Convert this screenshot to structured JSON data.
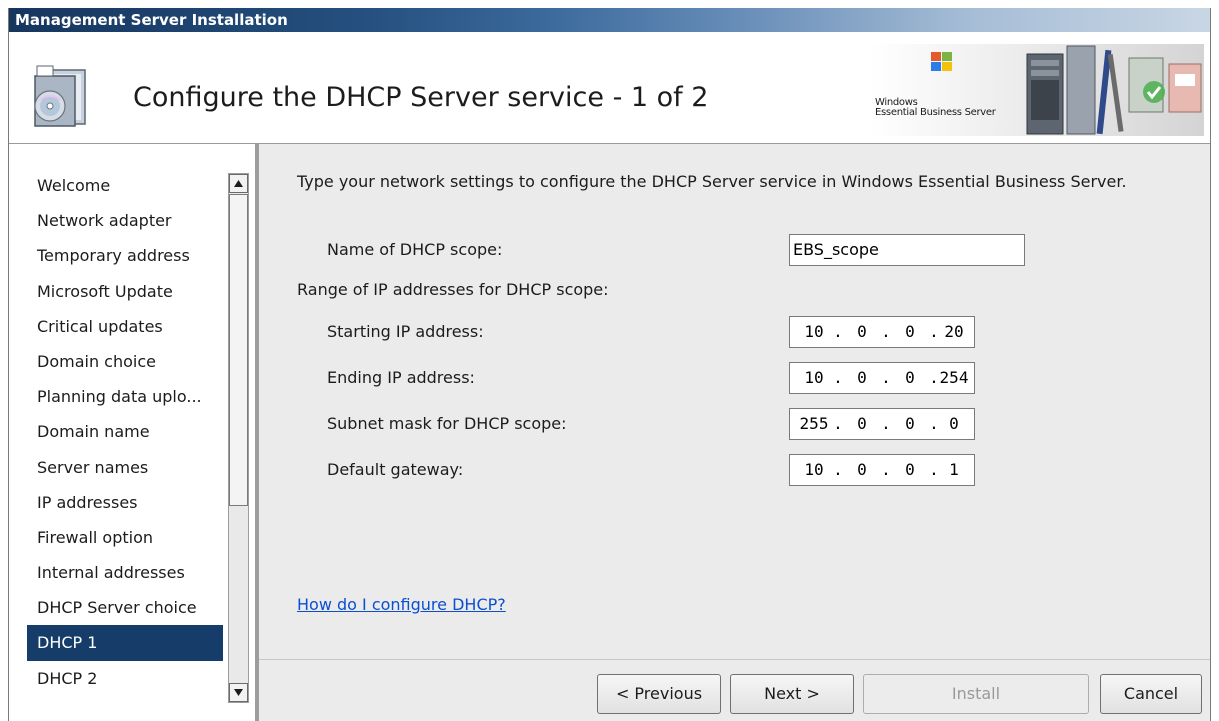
{
  "window": {
    "title": "Management Server Installation"
  },
  "header": {
    "title": "Configure the DHCP Server service - 1 of 2",
    "brand_line1": "Windows",
    "brand_line2": "Essential Business Server"
  },
  "sidebar": {
    "items": [
      {
        "label": "Welcome",
        "selected": false
      },
      {
        "label": "Network adapter",
        "selected": false
      },
      {
        "label": "Temporary address",
        "selected": false
      },
      {
        "label": "Microsoft Update",
        "selected": false
      },
      {
        "label": "Critical updates",
        "selected": false
      },
      {
        "label": "Domain choice",
        "selected": false
      },
      {
        "label": "Planning data uplo...",
        "selected": false
      },
      {
        "label": "Domain name",
        "selected": false
      },
      {
        "label": "Server names",
        "selected": false
      },
      {
        "label": "IP addresses",
        "selected": false
      },
      {
        "label": "Firewall option",
        "selected": false
      },
      {
        "label": "Internal addresses",
        "selected": false
      },
      {
        "label": "DHCP Server choice",
        "selected": false
      },
      {
        "label": "DHCP 1",
        "selected": true
      },
      {
        "label": "DHCP 2",
        "selected": false
      }
    ]
  },
  "main": {
    "instructions": "Type your network settings to configure the DHCP Server service in Windows Essential Business Server.",
    "scope_name_label": "Name of DHCP scope:",
    "scope_name_value": "EBS_scope",
    "range_label": "Range of IP addresses for DHCP scope:",
    "start_ip": {
      "label": "Starting IP address:",
      "octets": [
        "10",
        "0",
        "0",
        "20"
      ]
    },
    "end_ip": {
      "label": "Ending IP address:",
      "octets": [
        "10",
        "0",
        "0",
        "254"
      ]
    },
    "subnet_mask": {
      "label": "Subnet mask for DHCP scope:",
      "octets": [
        "255",
        "0",
        "0",
        "0"
      ]
    },
    "gateway": {
      "label": "Default gateway:",
      "octets": [
        "10",
        "0",
        "0",
        "1"
      ]
    },
    "help_link": "How do I configure DHCP?"
  },
  "footer": {
    "previous": "< Previous",
    "next": "Next >",
    "install": "Install",
    "cancel": "Cancel"
  },
  "colors": {
    "selection": "#163d6a",
    "link": "#0b4fd0",
    "titlebar_dark": "#16365e"
  }
}
